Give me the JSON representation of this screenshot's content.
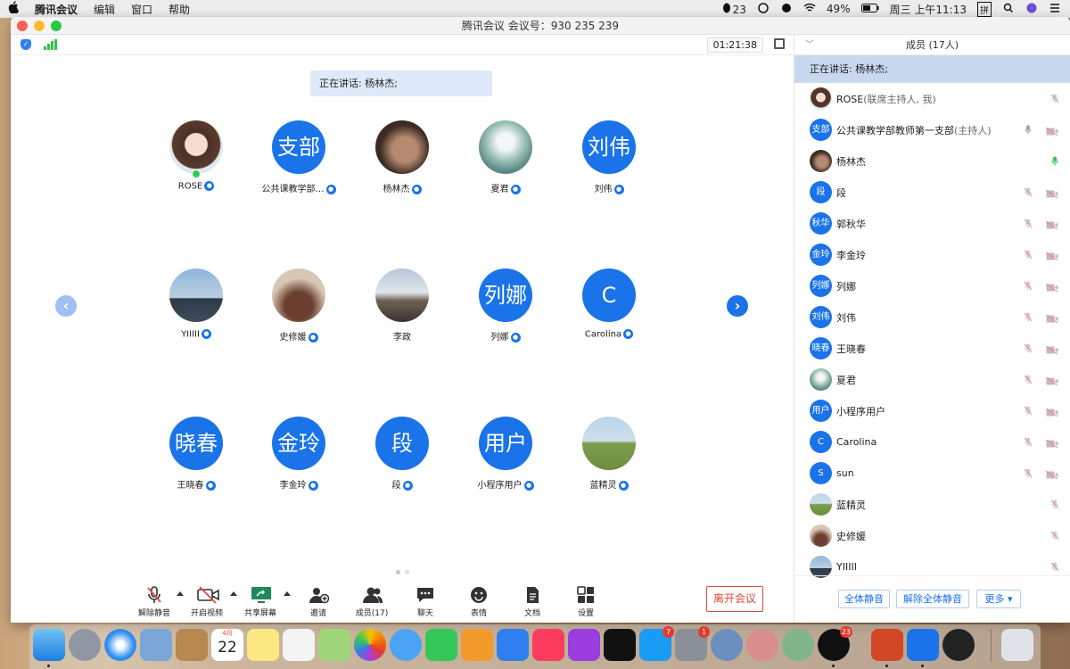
{
  "menubar": {
    "apple": "",
    "app_name": "腾讯会议",
    "menus": [
      "编辑",
      "窗口",
      "帮助"
    ],
    "qq_count": "23",
    "battery": "49%",
    "clock": "周三 上午11:13",
    "input_method": "拼"
  },
  "window": {
    "title": "腾讯会议 会议号：930 235 239",
    "timer": "01:21:38"
  },
  "speaking_banner": "正在讲话: 杨林杰;",
  "participants": [
    {
      "name": "ROSE",
      "initials": "",
      "photo": "anime"
    },
    {
      "name": "公共课教学部…",
      "initials": "支部",
      "photo": ""
    },
    {
      "name": "杨林杰",
      "initials": "",
      "photo": "face"
    },
    {
      "name": "夏君",
      "initials": "",
      "photo": "flowers"
    },
    {
      "name": "刘伟",
      "initials": "刘伟",
      "photo": ""
    },
    {
      "name": "YIIIII",
      "initials": "",
      "photo": "lake"
    },
    {
      "name": "史修媛",
      "initials": "",
      "photo": "room"
    },
    {
      "name": "李政",
      "initials": "",
      "photo": "man"
    },
    {
      "name": "列娜",
      "initials": "列娜",
      "photo": ""
    },
    {
      "name": "Carolina",
      "initials": "C",
      "photo": ""
    },
    {
      "name": "王晓春",
      "initials": "晓春",
      "photo": ""
    },
    {
      "name": "李金玲",
      "initials": "金玲",
      "photo": ""
    },
    {
      "name": "段",
      "initials": "段",
      "photo": ""
    },
    {
      "name": "小程序用户",
      "initials": "用户",
      "photo": ""
    },
    {
      "name": "蓝精灵",
      "initials": "",
      "photo": "horse"
    }
  ],
  "toolbar": {
    "unmute": "解除静音",
    "video": "开启视频",
    "share": "共享屏幕",
    "invite": "邀请",
    "members": "成员(17)",
    "chat": "聊天",
    "emoji": "表情",
    "docs": "文档",
    "settings": "设置",
    "leave": "离开会议"
  },
  "panel": {
    "title": "成员 (17人)",
    "speaking": "正在讲话: 杨林杰;",
    "members": [
      {
        "name": "ROSE",
        "role": "(联席主持人, 我)",
        "initials": "",
        "photo": "anime",
        "mic": "muted",
        "cam": false
      },
      {
        "name": "公共课教学部教师第一支部",
        "role": "(主持人)",
        "initials": "支部",
        "photo": "",
        "mic": "grey",
        "cam": true
      },
      {
        "name": "杨林杰",
        "role": "",
        "initials": "",
        "photo": "face",
        "mic": "green",
        "cam": false
      },
      {
        "name": "段",
        "role": "",
        "initials": "段",
        "photo": "",
        "mic": "muted",
        "cam": true
      },
      {
        "name": "郭秋华",
        "role": "",
        "initials": "秋华",
        "photo": "",
        "mic": "muted",
        "cam": true
      },
      {
        "name": "李金玲",
        "role": "",
        "initials": "金玲",
        "photo": "",
        "mic": "muted",
        "cam": true
      },
      {
        "name": "列娜",
        "role": "",
        "initials": "列娜",
        "photo": "",
        "mic": "muted",
        "cam": true
      },
      {
        "name": "刘伟",
        "role": "",
        "initials": "刘伟",
        "photo": "",
        "mic": "muted",
        "cam": true
      },
      {
        "name": "王晓春",
        "role": "",
        "initials": "晓春",
        "photo": "",
        "mic": "muted",
        "cam": true
      },
      {
        "name": "夏君",
        "role": "",
        "initials": "",
        "photo": "flowers",
        "mic": "muted",
        "cam": true
      },
      {
        "name": "小程序用户",
        "role": "",
        "initials": "用户",
        "photo": "",
        "mic": "muted",
        "cam": true
      },
      {
        "name": "Carolina",
        "role": "",
        "initials": "C",
        "photo": "",
        "mic": "muted",
        "cam": true
      },
      {
        "name": "sun",
        "role": "",
        "initials": "S",
        "photo": "",
        "mic": "muted",
        "cam": true
      },
      {
        "name": "蓝精灵",
        "role": "",
        "initials": "",
        "photo": "horse",
        "mic": "muted",
        "cam": false
      },
      {
        "name": "史修媛",
        "role": "",
        "initials": "",
        "photo": "room",
        "mic": "muted",
        "cam": false
      },
      {
        "name": "YIIIII",
        "role": "",
        "initials": "",
        "photo": "lake",
        "mic": "muted",
        "cam": false
      }
    ],
    "mute_all": "全体静音",
    "unmute_all": "解除全体静音",
    "more": "更多 ▾"
  },
  "dock": {
    "calendar_month": "4月",
    "calendar_day": "22",
    "appstore_badge": "7",
    "prefs_badge": "1",
    "qq_badge": "23"
  },
  "colors": {
    "accent": "#1a73e8",
    "leave": "#e0493b",
    "speaking_bg": "#c8d8ef"
  }
}
